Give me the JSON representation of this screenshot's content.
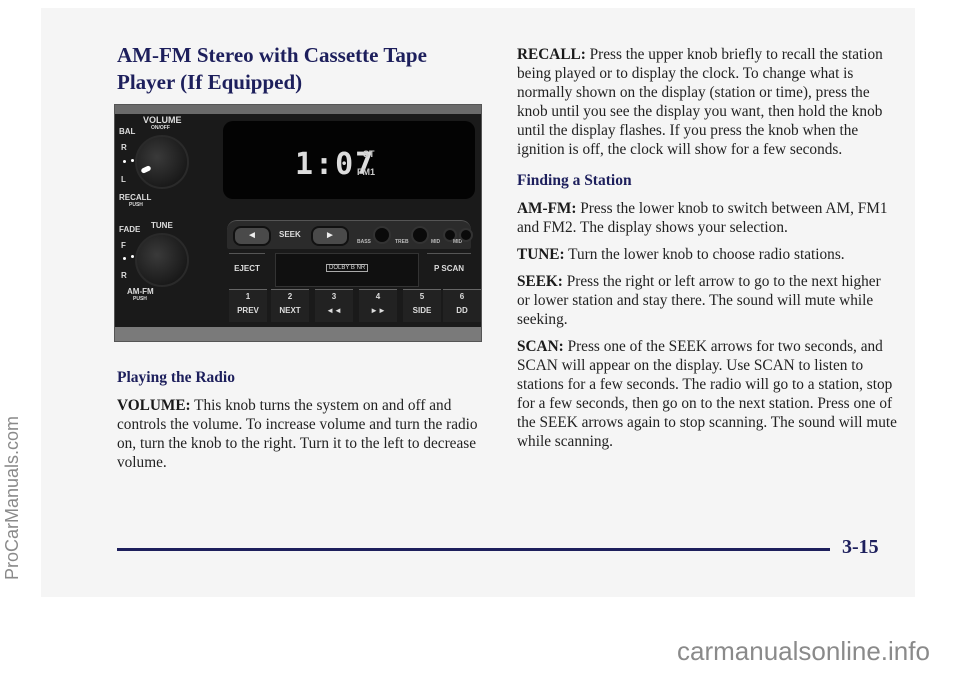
{
  "page": {
    "title": "AM-FM Stereo with Cassette Tape Player (If Equipped)",
    "page_number": "3-15",
    "accent_color": "#1d1f5c"
  },
  "radio_image": {
    "display_time": "1:07",
    "display_st": "ST",
    "display_band": "FM1",
    "labels": {
      "volume": "VOLUME",
      "volume_sub": "ON/OFF",
      "bal": "BAL",
      "r": "R",
      "l": "L",
      "recall": "RECALL",
      "recall_sub": "PUSH",
      "fade": "FADE",
      "tune": "TUNE",
      "f": "F",
      "r2": "R",
      "amfm": "AM-FM",
      "amfm_sub": "PUSH",
      "seek": "SEEK",
      "seek_left": "◄",
      "seek_right": "►",
      "bass": "BASS",
      "treb": "TREB",
      "mid": "MID",
      "mid2": "MID",
      "eject": "EJECT",
      "dolby": "DOLBY B NR",
      "pscan": "P SCAN"
    },
    "presets": [
      {
        "num": "1",
        "sub": "PREV"
      },
      {
        "num": "2",
        "sub": "NEXT"
      },
      {
        "num": "3",
        "sub": "◄◄"
      },
      {
        "num": "4",
        "sub": "►►"
      },
      {
        "num": "5",
        "sub": "SIDE"
      },
      {
        "num": "6",
        "sub": "DD"
      }
    ]
  },
  "left_column": {
    "heading": "Playing the Radio",
    "volume_term": "VOLUME:",
    "volume_text": " This knob turns the system on and off and controls the volume. To increase volume and turn the radio on, turn the knob to the right. Turn it to the left to decrease volume."
  },
  "right_column": {
    "recall_term": "RECALL:",
    "recall_text": " Press the upper knob briefly to recall the station being played or to display the clock. To change what is normally shown on the display (station or time), press the knob until you see the display you want, then hold the knob until the display flashes. If you press the knob when the ignition is off, the clock will show for a few seconds.",
    "finding_heading": "Finding a Station",
    "amfm_term": "AM-FM:",
    "amfm_text": " Press the lower knob to switch between AM, FM1 and FM2. The display shows your selection.",
    "tune_term": "TUNE:",
    "tune_text": " Turn the lower knob to choose radio stations.",
    "seek_term": "SEEK:",
    "seek_text": " Press the right or left arrow to go to the next higher or lower station and stay there. The sound will mute while seeking.",
    "scan_term": "SCAN:",
    "scan_text": " Press one of the SEEK arrows for two seconds, and SCAN will appear on the display. Use SCAN to listen to stations for a few seconds. The radio will go to a station, stop for a few seconds, then go on to the next station. Press one of the SEEK arrows again to stop scanning. The sound will mute while scanning."
  },
  "watermarks": {
    "side": "ProCarManuals.com",
    "bottom": "carmanualsonline.info"
  }
}
